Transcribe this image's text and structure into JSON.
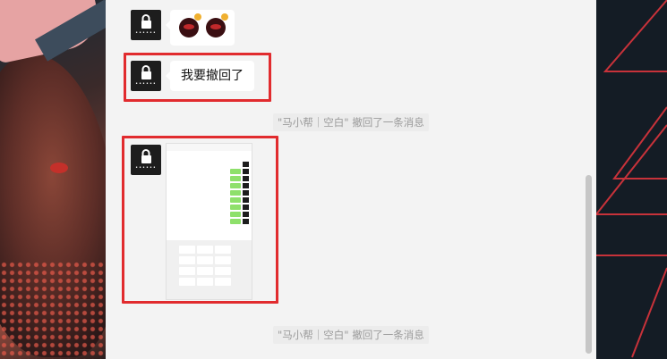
{
  "messages": [
    {
      "type": "emoji",
      "emojis": [
        "bomb-emoji",
        "bomb-emoji"
      ]
    },
    {
      "type": "text",
      "text": "我要撤回了"
    },
    {
      "type": "image",
      "alt": "screenshot"
    }
  ],
  "system_notices": [
    "\"马小帮｜空白\" 撤回了一条消息",
    "\"马小帮｜空白\" 撤回了一条消息"
  ],
  "avatar": {
    "icon": "lock-icon",
    "dots": "••••••"
  },
  "colors": {
    "highlight": "#e12b2e",
    "chat_bg": "#f3f3f3",
    "bubble": "#ffffff"
  }
}
